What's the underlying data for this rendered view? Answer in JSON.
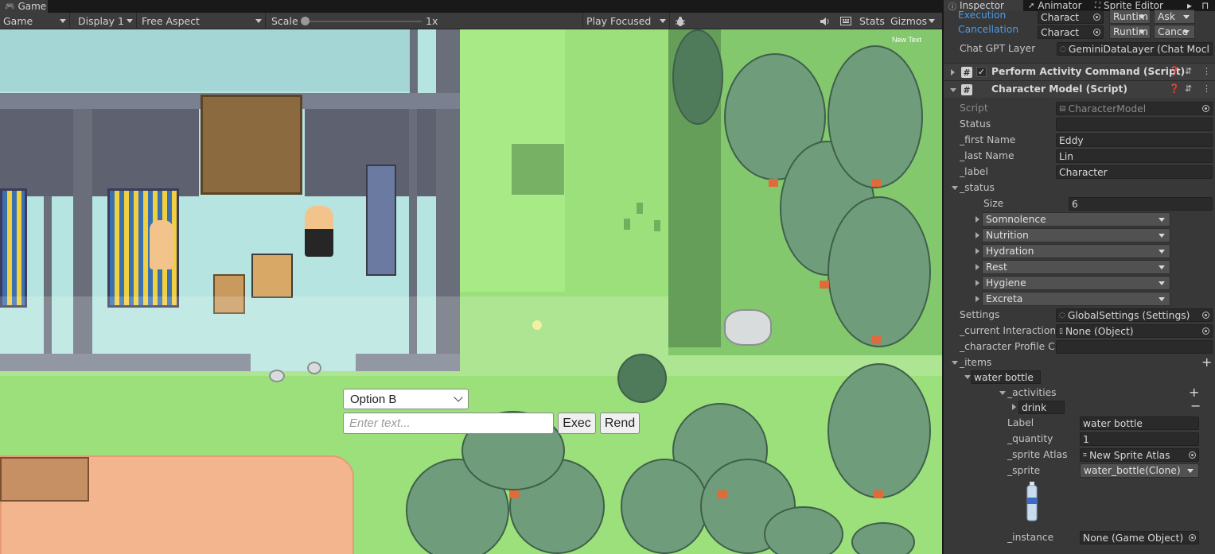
{
  "game": {
    "tab_label": "Game",
    "toolbar": {
      "mode": "Game",
      "display": "Display 1",
      "aspect": "Free Aspect",
      "scale_label": "Scale",
      "scale_value": "1x",
      "play_mode": "Play Focused",
      "stats": "Stats",
      "gizmos": "Gizmos"
    },
    "overlay_text": "New Text",
    "ui": {
      "dropdown_value": "Option B",
      "input_placeholder": "Enter text...",
      "exec_button": "Exec",
      "rend_button": "Rend"
    }
  },
  "inspector": {
    "tabs": [
      "Inspector",
      "Animator",
      "Sprite Editor"
    ],
    "top_rows": [
      {
        "label": "Execution",
        "obj": "Charact",
        "runtime": "Runtim",
        "value": "Ask"
      },
      {
        "label": "Cancellation",
        "obj": "Charact",
        "runtime": "Runtim",
        "value": "Cance"
      }
    ],
    "chat_gpt_layer": {
      "label": "Chat GPT Layer",
      "value": "GeminiDataLayer (Chat Mocl"
    },
    "components": [
      {
        "title": "Perform Activity Command (Script)",
        "enabled": true
      },
      {
        "title": "Character Model (Script)"
      }
    ],
    "fields": {
      "script": {
        "label": "Script",
        "value": "CharacterModel"
      },
      "status": {
        "label": "Status",
        "value": ""
      },
      "first_name": {
        "label": "_first Name",
        "value": "Eddy"
      },
      "last_name": {
        "label": "_last Name",
        "value": "Lin"
      },
      "label": {
        "label": "_label",
        "value": "Character"
      }
    },
    "status_list": {
      "label": "_status",
      "size_label": "Size",
      "size": "6",
      "items": [
        "Somnolence",
        "Nutrition",
        "Hydration",
        "Rest",
        "Hygiene",
        "Excreta"
      ]
    },
    "settings": {
      "label": "Settings",
      "value": "GlobalSettings (Settings)"
    },
    "current_interaction": {
      "label": "_current Interaction P",
      "value": "None (Object)"
    },
    "character_profile": {
      "label": "_character Profile Cor",
      "value": ""
    },
    "items": {
      "label": "_items",
      "entry": "water bottle",
      "activities_label": "_activities",
      "activity": "drink",
      "item_label": {
        "label": "Label",
        "value": "water bottle"
      },
      "quantity": {
        "label": "_quantity",
        "value": "1"
      },
      "sprite_atlas": {
        "label": "_sprite Atlas",
        "value": "New Sprite Atlas"
      },
      "sprite": {
        "label": "_sprite",
        "value": "water_bottle(Clone)"
      },
      "instance": {
        "label": "_instance",
        "value": "None (Game Object)"
      }
    }
  }
}
